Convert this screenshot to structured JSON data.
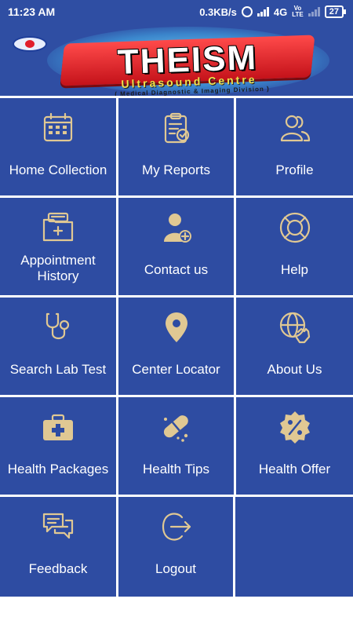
{
  "status_bar": {
    "time": "11:23 AM",
    "speed": "0.3KB/s",
    "network": "4G",
    "volte_top": "Vo",
    "volte_bottom": "LTE",
    "battery": "27"
  },
  "brand": {
    "name": "THEISM",
    "tagline": "Ultrasound Centre",
    "subline": "( Medical Diagnostic & Imaging Division )"
  },
  "menu": [
    {
      "label": "Home Collection",
      "icon": "calendar-icon"
    },
    {
      "label": "My Reports",
      "icon": "clipboard-icon"
    },
    {
      "label": "Profile",
      "icon": "users-icon"
    },
    {
      "label": "Appointment History",
      "icon": "folder-medical-icon"
    },
    {
      "label": "Contact us",
      "icon": "user-plus-icon"
    },
    {
      "label": "Help",
      "icon": "lifebuoy-icon"
    },
    {
      "label": "Search Lab Test",
      "icon": "stethoscope-icon"
    },
    {
      "label": "Center Locator",
      "icon": "map-pin-icon"
    },
    {
      "label": "About Us",
      "icon": "globe-hand-icon"
    },
    {
      "label": "Health Packages",
      "icon": "medical-kit-icon"
    },
    {
      "label": "Health Tips",
      "icon": "pills-icon"
    },
    {
      "label": "Health Offer",
      "icon": "discount-badge-icon"
    },
    {
      "label": "Feedback",
      "icon": "chat-bubbles-icon"
    },
    {
      "label": "Logout",
      "icon": "logout-icon"
    }
  ],
  "colors": {
    "tile": "#2e4ca2",
    "icon": "#e0c893",
    "status_bar": "#2f4ea3"
  }
}
